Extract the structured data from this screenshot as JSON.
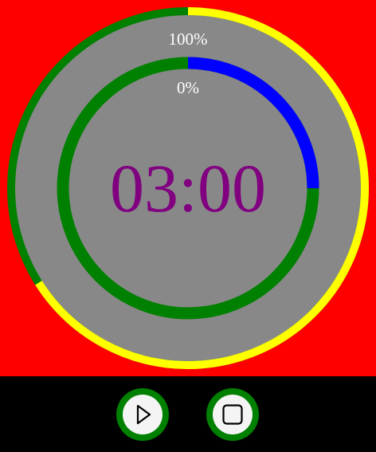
{
  "colors": {
    "background_top": "#ff0000",
    "face": "#888888",
    "outer_ring_progress": "#ffff00",
    "outer_ring_rest": "#008000",
    "inner_ring_progress": "#0000ff",
    "inner_ring_rest": "#008000",
    "time_text": "#800080",
    "label_text": "#ffffff",
    "controls_bg": "#000000",
    "button_ring": "#008000",
    "button_face": "#f4f4f4"
  },
  "timer": {
    "outer_label": "100%",
    "inner_label": "0%",
    "time": "03:00",
    "outer_ring_fraction": 0.66,
    "inner_ring_fraction": 0.25
  },
  "controls": {
    "play_icon": "play-icon",
    "stop_icon": "stop-icon"
  }
}
